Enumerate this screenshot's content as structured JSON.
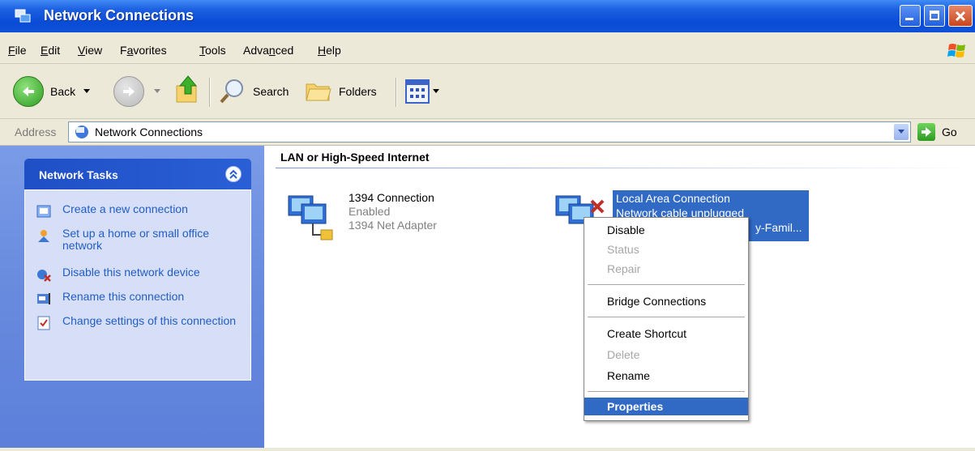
{
  "window": {
    "title": "Network Connections"
  },
  "menu": [
    {
      "label": "File",
      "mnemonic": "F"
    },
    {
      "label": "Edit",
      "mnemonic": "E"
    },
    {
      "label": "View",
      "mnemonic": "V"
    },
    {
      "label": "Favorites",
      "mnemonic": "a"
    },
    {
      "label": "Tools",
      "mnemonic": "T"
    },
    {
      "label": "Advanced",
      "mnemonic": "n"
    },
    {
      "label": "Help",
      "mnemonic": "H"
    }
  ],
  "toolbar": {
    "back_label": "Back",
    "search_label": "Search",
    "folders_label": "Folders"
  },
  "address": {
    "label": "Address",
    "value": "Network Connections",
    "go_label": "Go"
  },
  "tasks": {
    "title": "Network Tasks",
    "items": [
      {
        "label": "Create a new connection",
        "icon": "new-connection-icon"
      },
      {
        "label": "Set up a home or small office network",
        "icon": "home-network-icon"
      },
      {
        "label": "Disable this network device",
        "icon": "disable-device-icon"
      },
      {
        "label": "Rename this connection",
        "icon": "rename-icon"
      },
      {
        "label": "Change settings of this connection",
        "icon": "settings-icon"
      }
    ]
  },
  "content": {
    "group_title": "LAN or High-Speed Internet",
    "connections": [
      {
        "name": "1394 Connection",
        "status": "Enabled",
        "device": "1394 Net Adapter"
      },
      {
        "name": "Local Area Connection",
        "status": "Network cable unplugged",
        "device": "y-Famil..."
      }
    ]
  },
  "context_menu": {
    "items": [
      {
        "label": "Disable",
        "enabled": true
      },
      {
        "label": "Status",
        "enabled": false
      },
      {
        "label": "Repair",
        "enabled": false
      },
      {
        "label": "Bridge Connections",
        "enabled": true
      },
      {
        "label": "Create Shortcut",
        "enabled": true
      },
      {
        "label": "Delete",
        "enabled": false
      },
      {
        "label": "Rename",
        "enabled": true
      },
      {
        "label": "Properties",
        "enabled": true,
        "default": true,
        "highlighted": true
      }
    ]
  },
  "colors": {
    "titlebar": "#0a4bd6",
    "selection": "#316ac5",
    "task_link": "#215dc6",
    "taskpane": "#6688dd"
  }
}
